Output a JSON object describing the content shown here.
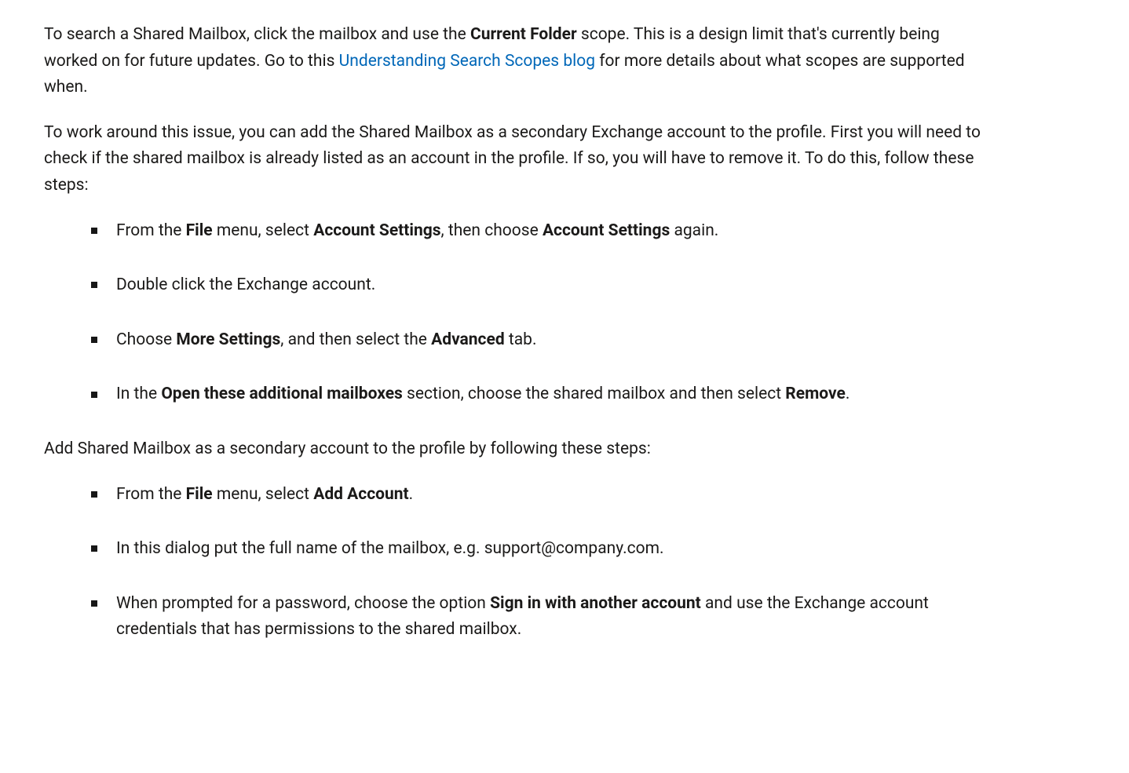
{
  "para1": {
    "seg1": "To search a Shared Mailbox, click the mailbox and use the ",
    "bold1": "Current Folder",
    "seg2": " scope. This is a design limit that's currently being worked on for future updates. Go to this ",
    "link_text": "Understanding Search Scopes blog",
    "seg3": " for more details about what scopes are supported when."
  },
  "para2": "To work around this issue, you can add the Shared Mailbox as a secondary Exchange account to the profile. First you will need to check if the shared mailbox is already listed as an account in the profile. If so, you will have to remove it. To do this, follow these steps:",
  "list1": {
    "item1": {
      "seg1": "From the ",
      "bold1": "File",
      "seg2": " menu, select ",
      "bold2": "Account Settings",
      "seg3": ", then choose ",
      "bold3": "Account Settings",
      "seg4": " again."
    },
    "item2": {
      "seg1": "Double click the Exchange account."
    },
    "item3": {
      "seg1": "Choose ",
      "bold1": "More Settings",
      "seg2": ", and then select the ",
      "bold2": "Advanced",
      "seg3": " tab."
    },
    "item4": {
      "seg1": "In the ",
      "bold1": "Open these additional mailboxes",
      "seg2": " section, choose the shared mailbox and then select ",
      "bold2": "Remove",
      "seg3": "."
    }
  },
  "para3": "Add Shared Mailbox as a secondary account to the profile by following these steps:",
  "list2": {
    "item1": {
      "seg1": "From the ",
      "bold1": "File",
      "seg2": " menu, select ",
      "bold2": "Add Account",
      "seg3": "."
    },
    "item2": {
      "seg1": "In this dialog put the full name of the mailbox, e.g. support@company.com."
    },
    "item3": {
      "seg1": "When prompted for a password, choose the option ",
      "bold1": "Sign in with another account",
      "seg2": " and use the Exchange account credentials that has permissions to the shared mailbox."
    }
  }
}
